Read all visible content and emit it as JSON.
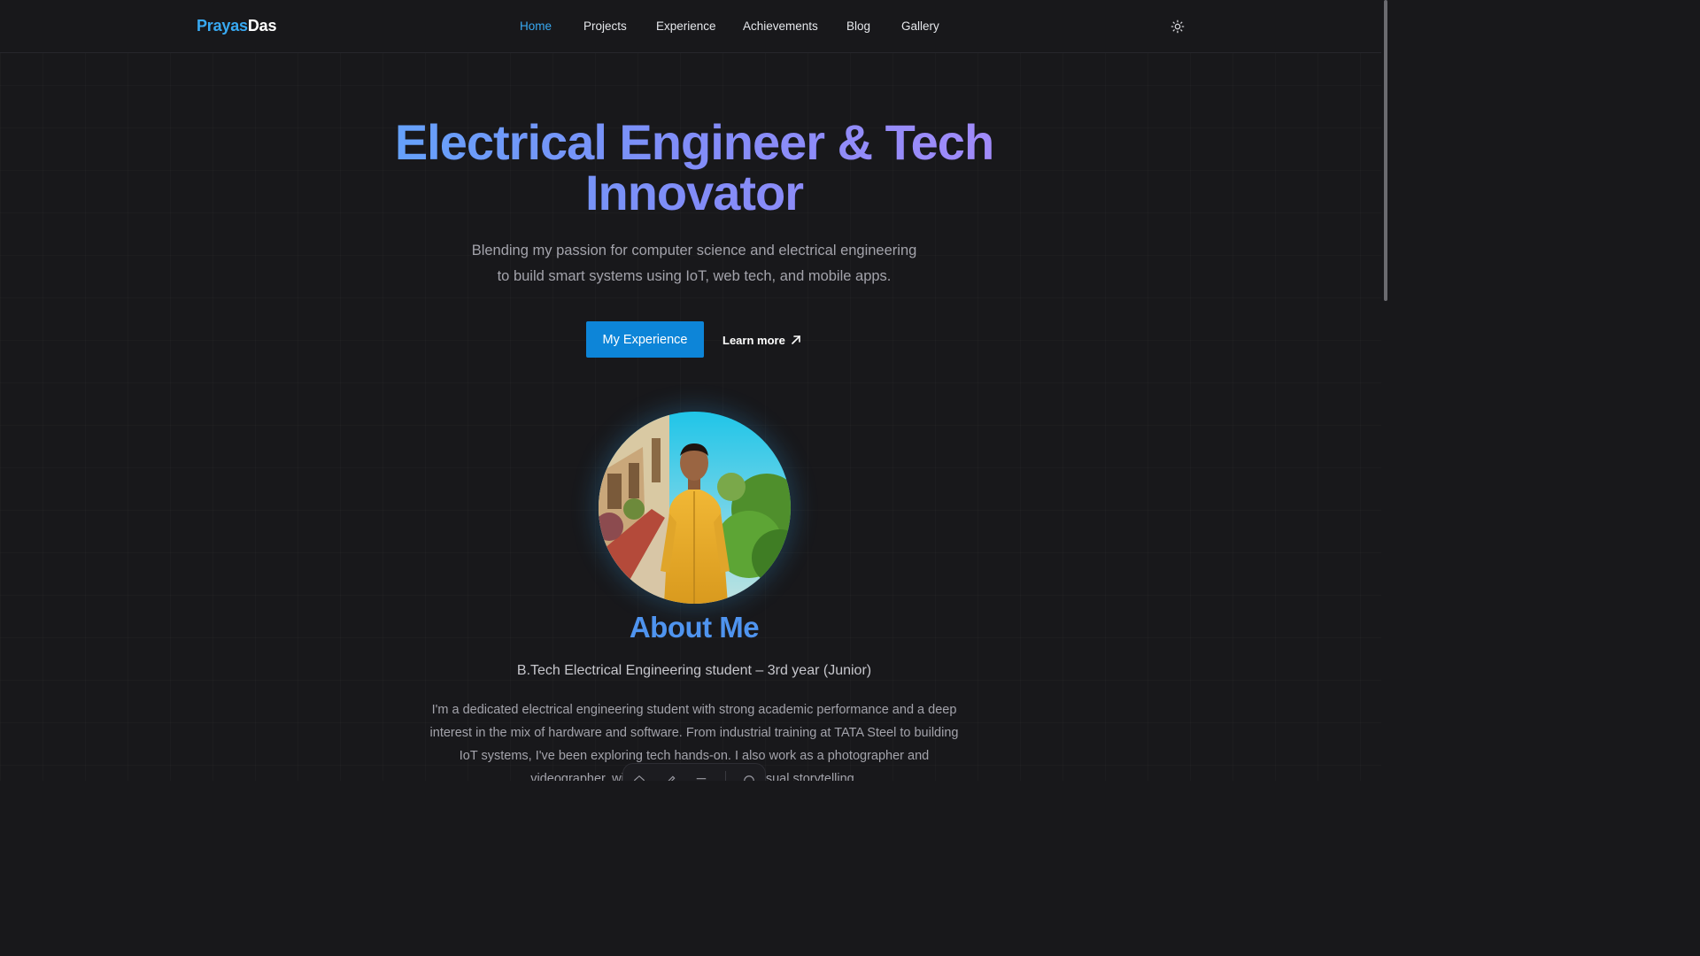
{
  "header": {
    "logo_first": "Prayas",
    "logo_second": "Das",
    "nav": [
      {
        "label": "Home",
        "active": true
      },
      {
        "label": "Projects"
      },
      {
        "label": "Experience"
      },
      {
        "label": "Achievements"
      },
      {
        "label": "Blog"
      },
      {
        "label": "Gallery"
      }
    ],
    "theme_toggle_icon": "sun-icon"
  },
  "hero": {
    "title_line1": "Electrical Engineer & Tech",
    "title_line2": "Innovator",
    "subtitle_line1": "Blending my passion for computer science and electrical engineering",
    "subtitle_line2": "to build smart systems using IoT, web tech, and mobile apps.",
    "primary_button": "My Experience",
    "secondary_link": "Learn more"
  },
  "about": {
    "title": "About Me",
    "subtitle": "B.Tech Electrical Engineering student – 3rd year (Junior)",
    "body_line1": "I'm a dedicated electrical engineering student with strong academic performance and a deep",
    "body_line2": "interest in the mix of hardware and software. From industrial training at TATA Steel to building",
    "body_line3": "IoT systems, I've been exploring tech hands-on. I also work as a photographer and",
    "body_line4_start": "videographer, wi",
    "body_line4_end": "sual storytelling."
  },
  "dock": {
    "items": [
      "home-icon",
      "pencil-icon",
      "menu-icon",
      "github-icon"
    ]
  },
  "colors": {
    "accent": "#38a9f2",
    "button": "#0d85d8",
    "about_title": "#4f94ef",
    "background": "#18181b"
  }
}
